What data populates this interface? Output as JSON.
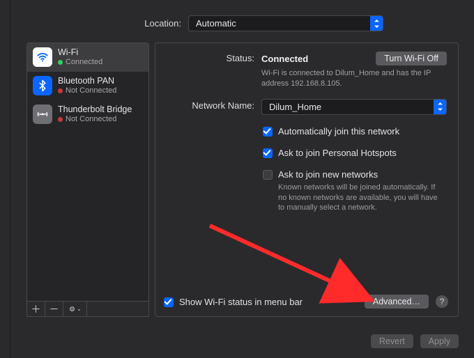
{
  "location": {
    "label": "Location:",
    "value": "Automatic"
  },
  "sidebar": {
    "items": [
      {
        "name": "Wi-Fi",
        "status_label": "Connected",
        "status": "green"
      },
      {
        "name": "Bluetooth PAN",
        "status_label": "Not Connected",
        "status": "red"
      },
      {
        "name": "Thunderbolt Bridge",
        "status_label": "Not Connected",
        "status": "red"
      }
    ]
  },
  "main": {
    "status_label": "Status:",
    "status_value": "Connected",
    "toggle_button": "Turn Wi-Fi Off",
    "status_desc": "Wi-Fi is connected to Dilum_Home and has the IP address 192.168.8.105.",
    "network_label": "Network Name:",
    "network_value": "Dilum_Home",
    "auto_join": "Automatically join this network",
    "ask_hotspot": "Ask to join Personal Hotspots",
    "ask_new": "Ask to join new networks",
    "ask_new_desc": "Known networks will be joined automatically. If no known networks are available, you will have to manually select a network.",
    "show_menubar": "Show Wi-Fi status in menu bar",
    "advanced": "Advanced…",
    "help": "?"
  },
  "footer": {
    "revert": "Revert",
    "apply": "Apply"
  }
}
